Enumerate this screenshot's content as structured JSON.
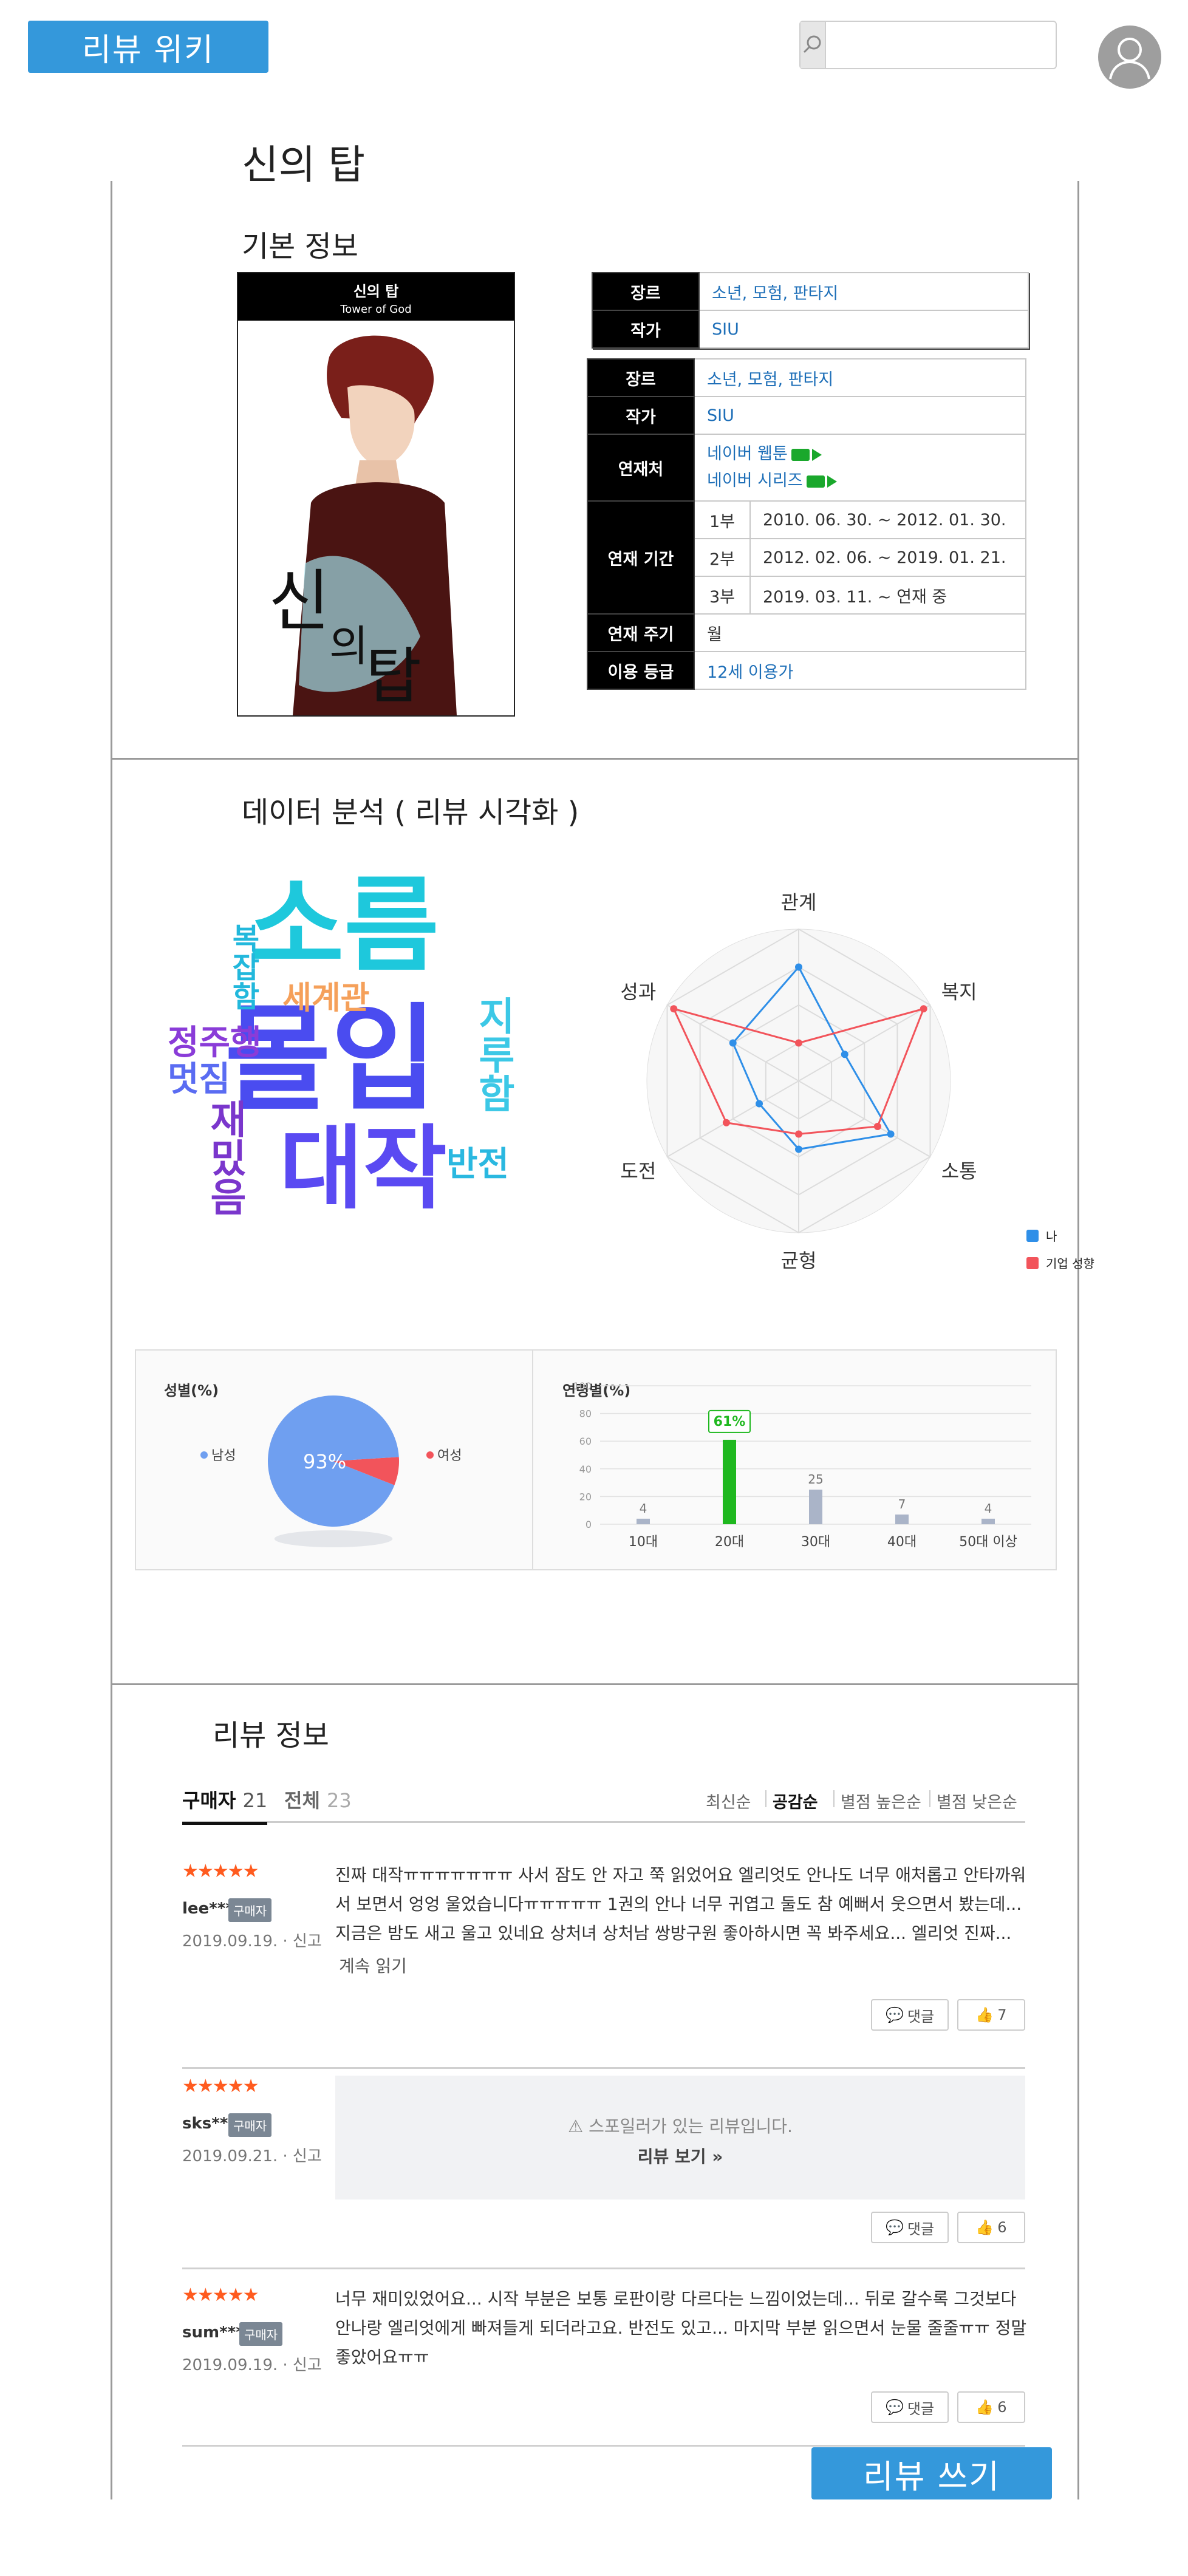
{
  "header": {
    "logo_label": "리뷰 위키",
    "search_placeholder": "",
    "search_value": ""
  },
  "page_title": "신의 탑",
  "basic_info": {
    "section_title": "기본 정보",
    "cover": {
      "title": "신의 탑",
      "subtitle": "Tower of God"
    },
    "card_overlap": {
      "rows": [
        {
          "key": "장르",
          "value": "소년, 모험, 판타지"
        },
        {
          "key": "작가",
          "value": "SIU"
        }
      ]
    },
    "card": {
      "genre_key": "장르",
      "genre_value": "소년, 모험, 판타지",
      "author_key": "작가",
      "author_value": "SIU",
      "platform_key": "연재처",
      "platform_1": "네이버 웹툰",
      "platform_2": "네이버 시리즈",
      "period_key": "연재 기간",
      "parts": [
        {
          "part": "1부",
          "date": "2010. 06. 30. ~ 2012. 01. 30."
        },
        {
          "part": "2부",
          "date": "2012. 02. 06. ~ 2019. 01. 21."
        },
        {
          "part": "3부",
          "date": "2019. 03. 11. ~ 연재 중"
        }
      ],
      "cycle_key": "연재 주기",
      "cycle_value": "월",
      "rating_key": "이용 등급",
      "rating_value": "12세 이용가"
    }
  },
  "analysis": {
    "section_title": "데이터 분석 ( 리뷰 시각화 )",
    "word_cloud": [
      {
        "word": "소름",
        "color": "#1ec8dc"
      },
      {
        "word": "몰입",
        "color": "#4a4cf0"
      },
      {
        "word": "대작",
        "color": "#5a4af2"
      },
      {
        "word": "세계관",
        "color": "#f5a05a"
      },
      {
        "word": "정주행",
        "color": "#8a3cd8"
      },
      {
        "word": "멋짐",
        "color": "#5a6cf2"
      },
      {
        "word": "복잡함",
        "color": "#22b8dc"
      },
      {
        "word": "재밌음",
        "color": "#7a36cc"
      },
      {
        "word": "지루함",
        "color": "#3cc8e6"
      },
      {
        "word": "반전",
        "color": "#2ab8e0"
      }
    ]
  },
  "chart_data": [
    {
      "type": "radar",
      "categories": [
        "관계",
        "복지",
        "소통",
        "균형",
        "도전",
        "성과"
      ],
      "series": [
        {
          "name": "나",
          "color": "#2f8fe8",
          "values": [
            0.75,
            0.35,
            0.7,
            0.45,
            0.3,
            0.5
          ]
        },
        {
          "name": "기업 성향",
          "color": "#f2545b",
          "values": [
            0.25,
            0.95,
            0.6,
            0.35,
            0.55,
            0.95
          ]
        }
      ]
    },
    {
      "type": "pie",
      "title": "성별(%)",
      "slices": [
        {
          "label": "남성",
          "value": 93,
          "color": "#6f9ff0"
        },
        {
          "label": "여성",
          "value": 7,
          "color": "#f2545b"
        }
      ],
      "center_label": "93%"
    },
    {
      "type": "bar",
      "title": "연령별(%)",
      "categories": [
        "10대",
        "20대",
        "30대",
        "40대",
        "50대 이상"
      ],
      "values": [
        4,
        61,
        25,
        7,
        4
      ],
      "highlight_index": 1,
      "highlight_label": "61%",
      "ylim": [
        0,
        100
      ],
      "yticks": [
        0,
        20,
        40,
        60,
        80,
        100
      ]
    }
  ],
  "reviews": {
    "section_title": "리뷰 정보",
    "tab_buyers": "구매자",
    "tab_buyers_count": "21",
    "tab_all": "전체",
    "tab_all_count": "23",
    "sort_options": [
      "최신순",
      "공감순",
      "별점 높은순",
      "별점 낮은순"
    ],
    "active_sort": "공감순",
    "items": [
      {
        "stars": "★★★★★",
        "user": "lee***",
        "badge": "구매자",
        "date": "2019.09.19. · 신고",
        "text": "진짜 대작ㅠㅠㅠㅠㅠㅠㅠ 사서 잠도 안 자고 쭉 읽었어요 엘리엇도 안나도 너무 애처롭고 안타까워서 보면서 엉엉 울었습니다ㅠㅠㅠㅠㅠ 1권의 안나 너무 귀엽고 둘도 참 예뻐서 웃으면서 봤는데... 지금은 밤도 새고 울고 있네요 상처녀 상처남 쌍방구원 좋아하시면 꼭 봐주세요... 엘리엇 진짜...",
        "more": "계속 읽기",
        "comment_label": "댓글",
        "likes": "7"
      },
      {
        "stars": "★★★★★",
        "user": "sks***",
        "badge": "구매자",
        "date": "2019.09.21. · 신고",
        "spoiler_notice": "스포일러가 있는 리뷰입니다.",
        "spoiler_link": "리뷰 보기 »",
        "comment_label": "댓글",
        "likes": "6"
      },
      {
        "stars": "★★★★★",
        "user": "sum***",
        "badge": "구매자",
        "date": "2019.09.19. · 신고",
        "text": "너무 재미있었어요... 시작 부분은 보통 로판이랑 다르다는 느낌이었는데... 뒤로 갈수록 그것보다 안나랑 엘리엇에게 빠져들게 되더라고요. 반전도 있고... 마지막 부분 읽으면서 눈물 줄줄ㅠㅠ 정말 좋았어요ㅠㅠ",
        "comment_label": "댓글",
        "likes": "6"
      }
    ],
    "write_button": "리뷰 쓰기"
  },
  "colors": {
    "brand": "#3498db",
    "link": "#1e6fb8",
    "star": "#ff5b1f",
    "bar_highlight": "#1fb81f",
    "bar_default": "#aab4c8"
  }
}
